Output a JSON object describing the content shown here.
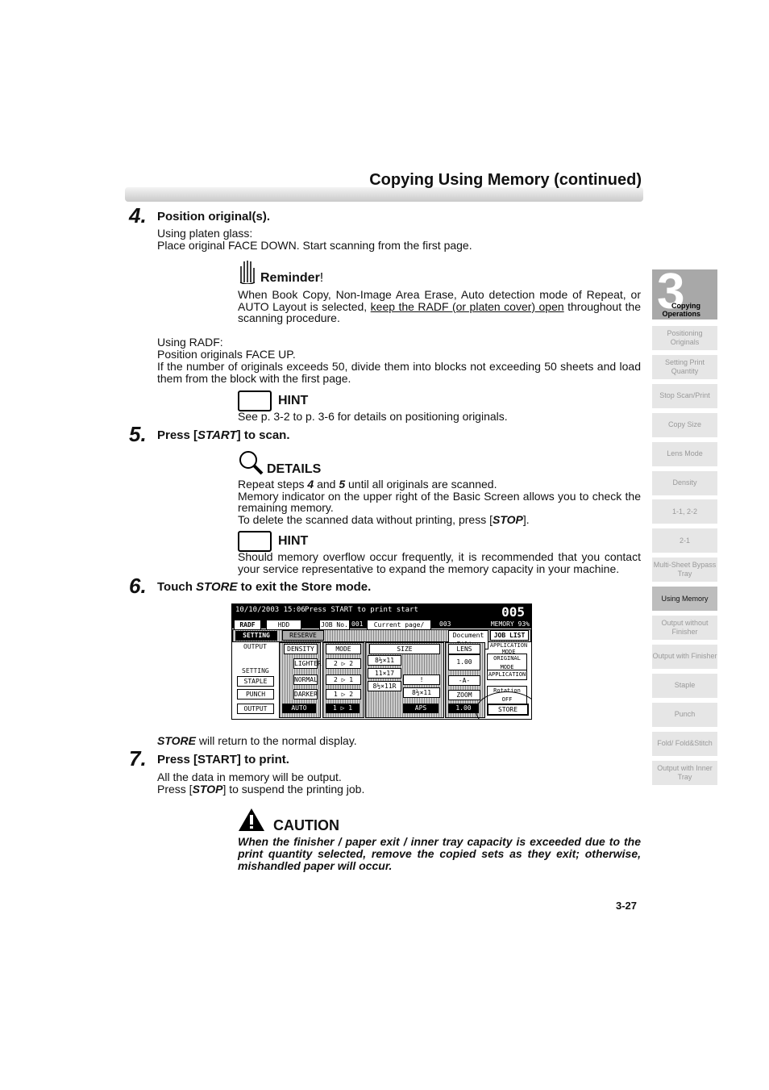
{
  "header": {
    "title": "Copying Using Memory (continued)"
  },
  "steps": [
    {
      "num": "4.",
      "heading": "Position original(s).",
      "lines": [
        "Using platen glass:",
        "Place original FACE DOWN. Start scanning from the first page."
      ],
      "reminder": {
        "label": "Reminder",
        "excl": "!",
        "text_before": "When Book Copy, Non-Image Area Erase, Auto detection mode of Repeat, or AUTO Layout is selected, ",
        "link": "keep the RADF (or platen cover) open",
        "text_after": " throughout the scanning procedure."
      },
      "lines2": [
        "Using RADF:",
        "Position originals FACE UP.",
        "If the number of originals exceeds 50, divide them into blocks not exceeding 50 sheets and load them from the block with the first page."
      ],
      "hint": {
        "label": "HINT",
        "text": "See p. 3-2 to p. 3-6 for details on positioning originals."
      }
    },
    {
      "num": "5.",
      "heading_pre": "Press [",
      "heading_em": "START",
      "heading_post": "] to scan.",
      "details": {
        "label": "DETAILS",
        "l1_a": "Repeat steps ",
        "l1_b": "4",
        "l1_c": " and ",
        "l1_d": "5",
        "l1_e": " until all originals are scanned.",
        "l2": "Memory indicator on the upper right of the Basic Screen allows you to check the remaining memory.",
        "l3_a": "To delete the scanned data without printing, press [",
        "l3_b": "STOP",
        "l3_c": "]."
      },
      "hint": {
        "label": "HINT",
        "text": "Should memory overflow occur frequently, it is recommended that you contact your service representative to expand the memory capacity in your machine."
      }
    },
    {
      "num": "6.",
      "heading_pre": "Touch ",
      "heading_em": "STORE",
      "heading_post": " to exit the Store mode.",
      "after_em": "STORE",
      "after": " will return to the normal display."
    },
    {
      "num": "7.",
      "heading": "Press [START] to print.",
      "l1": "All the data in memory will be output.",
      "l2_a": "Press [",
      "l2_b": "STOP",
      "l2_c": "] to suspend the printing job.",
      "caution": {
        "label": "CAUTION",
        "text": "When the finisher / paper exit / inner tray capacity is exceeded due to the print quantity selected, remove the copied sets as they exit; otherwise, mishandled paper will occur."
      }
    }
  ],
  "lcd": {
    "datetime": "10/10/2003 15:06",
    "message": "Press START to print start",
    "count": "005",
    "radf": "RADF",
    "hdd": "HDD Ready",
    "job_no_label": "JOB No.",
    "job_no": "001",
    "page_label": "Current page/ Total page",
    "pages": "003",
    "memory": "MEMORY 93%",
    "setting_tab": "SETTING",
    "reserve_tab": "RESERVE",
    "doc_filter": "Document Filter",
    "job_list": "JOB LIST",
    "output": "OUTPUT",
    "setting": "SETTING",
    "staple": "STAPLE",
    "punch": "PUNCH",
    "output_btn": "OUTPUT",
    "density": "DENSITY",
    "lighter": "LIGHTER",
    "normal": "NORMAL",
    "darker": "DARKER",
    "auto": "AUTO",
    "mode": "MODE",
    "m1": "2 ▷ 2",
    "m2": "2 ▷ 1",
    "m3": "1 ▷ 2",
    "m4": "1 ▷ 1",
    "size": "SIZE",
    "s1": "8½×11",
    "s2": "11×17",
    "s3": "8½×11R",
    "s4": "!",
    "s5": "8½×11",
    "aps": "APS",
    "lens": "LENS",
    "lens_val": "1.00",
    "a": "-A-",
    "zoom": "ZOOM",
    "zoom_val": "1.00",
    "app_mode": "APPLICATION MODE",
    "original_mode": "ORIGINAL MODE",
    "application": "APPLICATION",
    "rotation": "Rotation OFF",
    "store": "STORE"
  },
  "sidebar": {
    "chapter_num": "3",
    "chapter": "Copying Operations",
    "items": [
      "Positioning Originals",
      "Setting Print Quantity",
      "Stop Scan/Print",
      "Copy Size",
      "Lens Mode",
      "Density",
      "1-1, 2-2",
      "2-1",
      "Multi-Sheet Bypass Tray",
      "Using Memory",
      "Output without Finisher",
      "Output with Finisher",
      "Staple",
      "Punch",
      "Fold/ Fold&Stitch",
      "Output with Inner Tray"
    ],
    "active": "Using Memory"
  },
  "footer": {
    "page": "3-27"
  }
}
